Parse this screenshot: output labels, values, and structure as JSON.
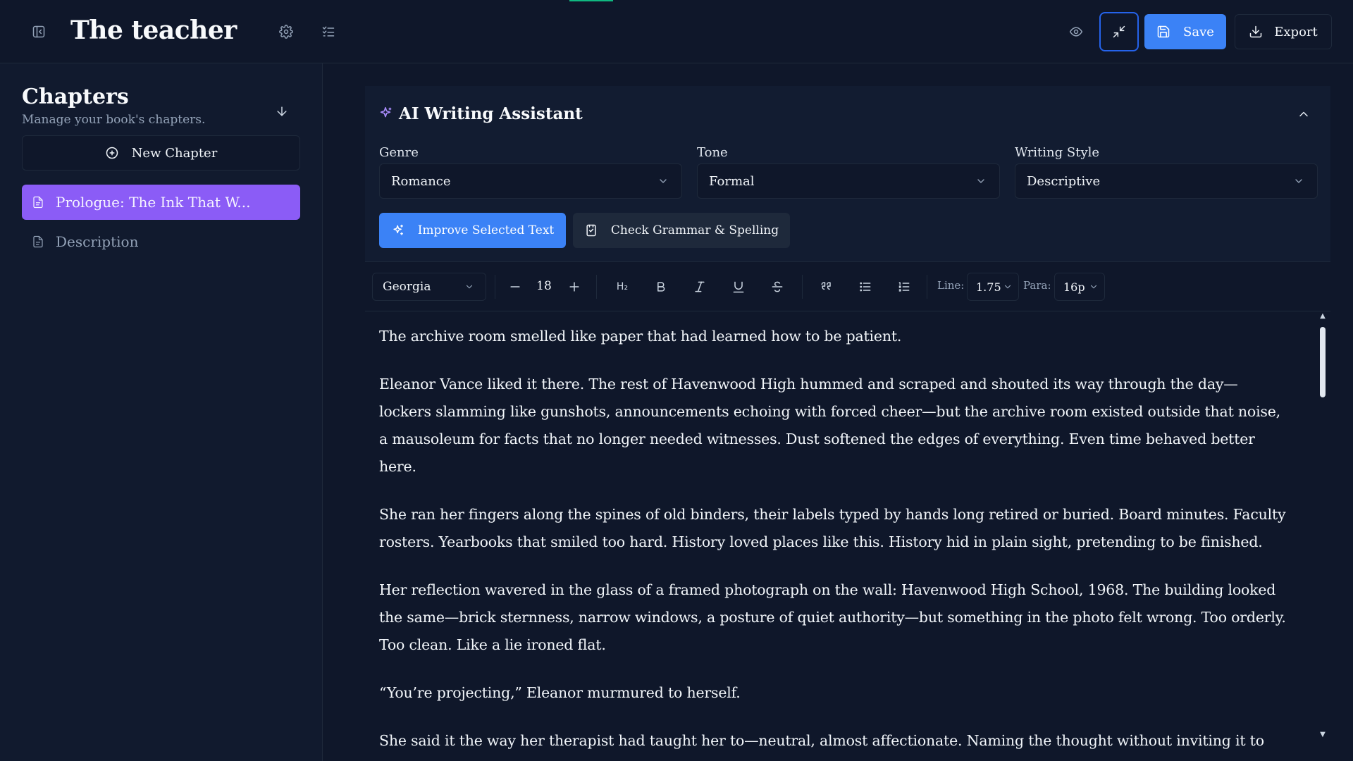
{
  "header": {
    "title": "The teacher",
    "save_label": "Save",
    "export_label": "Export"
  },
  "sidebar": {
    "title": "Chapters",
    "subtitle": "Manage your book's chapters.",
    "new_chapter_label": "New Chapter",
    "chapters": [
      {
        "label": "Prologue: The Ink That W...",
        "active": true
      },
      {
        "label": "Description",
        "active": false
      }
    ]
  },
  "assistant": {
    "title": "AI Writing Assistant",
    "genre": {
      "label": "Genre",
      "value": "Romance"
    },
    "tone": {
      "label": "Tone",
      "value": "Formal"
    },
    "style": {
      "label": "Writing Style",
      "value": "Descriptive"
    },
    "improve_label": "Improve Selected Text",
    "grammar_label": "Check Grammar & Spelling"
  },
  "toolbar": {
    "font": "Georgia",
    "font_size": "18",
    "line_label": "Line:",
    "line_value": "1.75",
    "para_label": "Para:",
    "para_value": "16p",
    "heading_label": "H₂"
  },
  "editor": {
    "paragraphs": [
      "The archive room smelled like paper that had learned how to be patient.",
      "Eleanor Vance liked it there. The rest of Havenwood High hummed and scraped and shouted its way through the day—lockers slamming like gunshots, announcements echoing with forced cheer—but the archive room existed outside that noise, a mausoleum for facts that no longer needed witnesses. Dust softened the edges of everything. Even time behaved better here.",
      "She ran her fingers along the spines of old binders, their labels typed by hands long retired or buried. Board minutes. Faculty rosters. Yearbooks that smiled too hard. History loved places like this. History hid in plain sight, pretending to be finished.",
      "Her reflection wavered in the glass of a framed photograph on the wall: Havenwood High School, 1968. The building looked the same—brick sternness, narrow windows, a posture of quiet authority—but something in the photo felt wrong. Too orderly. Too clean. Like a lie ironed flat.",
      "“You’re projecting,” Eleanor murmured to herself.",
      "She said it the way her therapist had taught her to—neutral, almost affectionate. Naming the thought without inviting it to dinner."
    ]
  },
  "colors": {
    "background": "#0f172a",
    "accent_blue": "#3b82f6",
    "accent_purple": "#8b5cf6",
    "progress_green": "#10b981"
  }
}
